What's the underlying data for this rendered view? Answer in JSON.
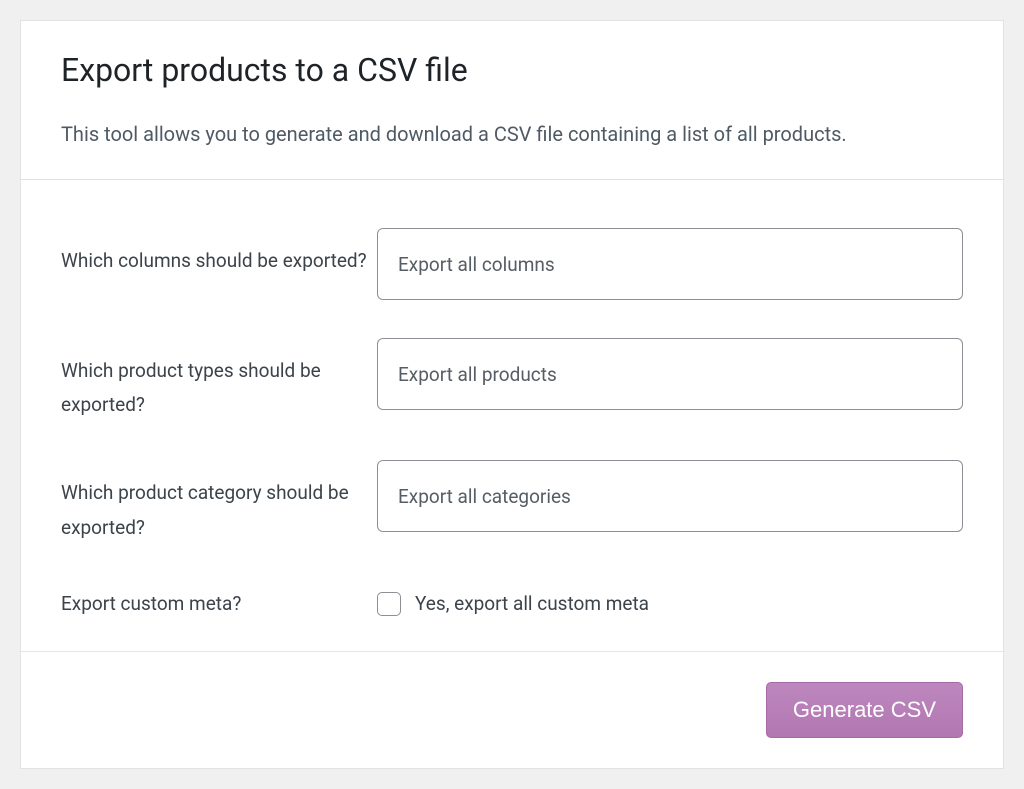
{
  "header": {
    "title": "Export products to a CSV file",
    "description": "This tool allows you to generate and download a CSV file containing a list of all products."
  },
  "form": {
    "columns": {
      "label": "Which columns should be exported?",
      "placeholder": "Export all columns"
    },
    "types": {
      "label": "Which product types should be exported?",
      "placeholder": "Export all products"
    },
    "category": {
      "label": "Which product category should be exported?",
      "placeholder": "Export all categories"
    },
    "meta": {
      "label": "Export custom meta?",
      "checkbox_label": "Yes, export all custom meta"
    }
  },
  "footer": {
    "generate_label": "Generate CSV"
  }
}
